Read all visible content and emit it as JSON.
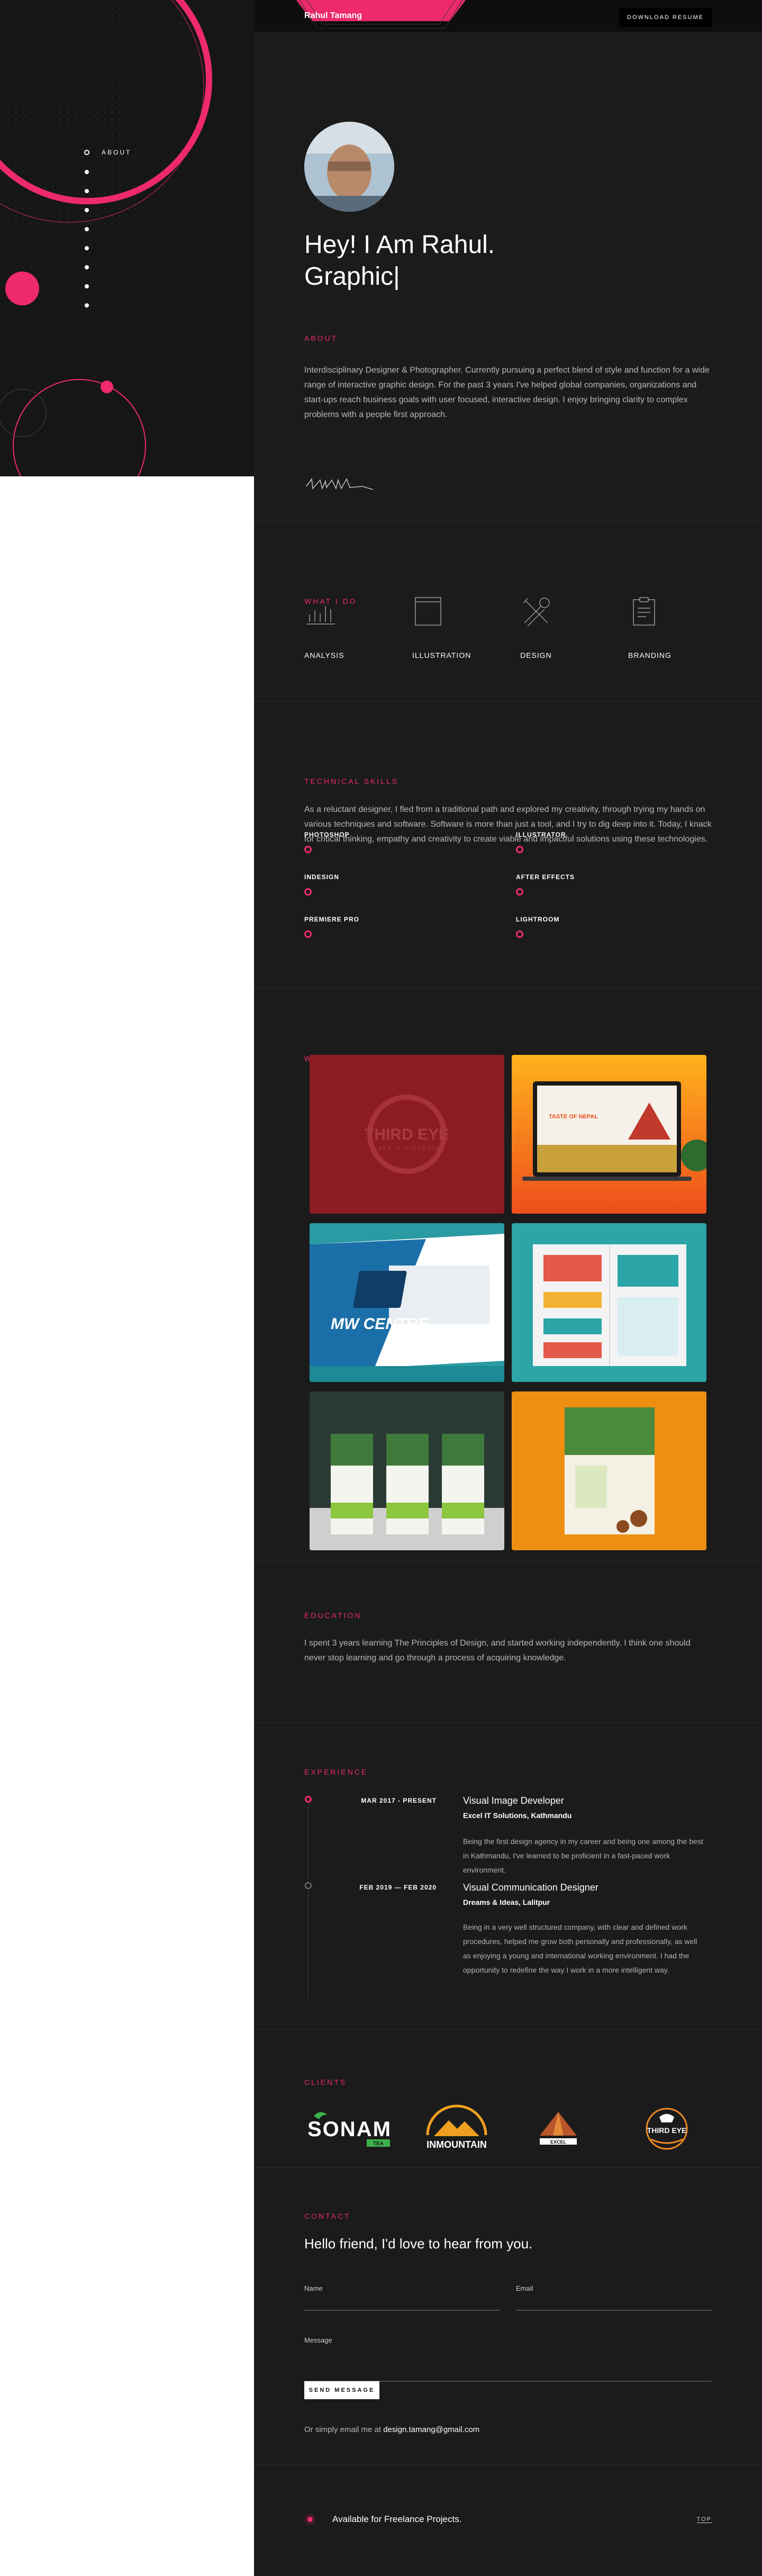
{
  "header": {
    "brand": "Rahul Tamang",
    "resume_button": "DOWNLOAD RESUME"
  },
  "sidenav": {
    "active_label": "ABOUT",
    "items": [
      "about",
      "what-i-do",
      "technical-skills",
      "work",
      "education",
      "experience",
      "clients",
      "contact",
      "footer"
    ]
  },
  "hero": {
    "greeting": "Hey! I Am Rahul.",
    "role": "Graphic"
  },
  "about": {
    "title": "ABOUT",
    "text": "Interdisciplinary Designer & Photographer. Currently pursuing a perfect blend of style and function for a wide range of interactive graphic design. For the past 3 years I've helped global companies, organizations and start-ups reach business goals with user focused, interactive design. I enjoy bringing clarity to complex problems with a people first approach."
  },
  "services": {
    "title": "WHAT I DO",
    "items": [
      {
        "label": "ANALYSIS",
        "icon": "bar-chart-icon"
      },
      {
        "label": "ILLUSTRATION",
        "icon": "browser-window-icon"
      },
      {
        "label": "DESIGN",
        "icon": "tools-icon"
      },
      {
        "label": "BRANDING",
        "icon": "clipboard-icon"
      }
    ]
  },
  "skills": {
    "title": "TECHNICAL SKILLS",
    "text": "As a reluctant designer, I fled from a traditional path and explored my creativity, through trying my hands on various techniques and software. Software is more than just a tool, and I try to dig deep into it. Today, I knack for critical thinking, empathy and creativity to create viable and impactful solutions using these technologies.",
    "items": [
      "PHOTOSHOP",
      "ILLUSTRATOR",
      "INDESIGN",
      "AFTER EFFECTS",
      "PREMIERE PRO",
      "LIGHTROOM"
    ]
  },
  "work": {
    "title": "WORK",
    "items": [
      {
        "name": "third-eye-logo-work",
        "caption": "THIRD EYE",
        "sub": "CAFE & PIZZERIA"
      },
      {
        "name": "taste-of-home-web-work",
        "caption": "TASTE OF NEPAL"
      },
      {
        "name": "mw-centre-work",
        "caption": "MW CENTRE"
      },
      {
        "name": "brochure-work",
        "caption": ""
      },
      {
        "name": "tea-packaging-work",
        "caption": ""
      },
      {
        "name": "pouch-packaging-work",
        "caption": ""
      }
    ]
  },
  "education": {
    "title": "EDUCATION",
    "text": "I spent 3 years learning The Principles of Design, and started working independently. I think one should never stop learning and go through a process of acquiring knowledge."
  },
  "experience": {
    "title": "EXPERIENCE",
    "items": [
      {
        "date": "MAR 2017 - PRESENT",
        "role": "Visual Image Developer",
        "company": "Excel IT Solutions, Kathmandu",
        "desc": "Being the first design agency in my career and being one among the best in Kathmandu, I've learned to be proficient in a fast-paced work environment."
      },
      {
        "date": "FEB 2019 — FEB 2020",
        "role": "Visual Communication Designer",
        "company": "Dreams & Ideas, Lalitpur",
        "desc": "Being in a very well structured company, with clear and defined work procedures, helped me grow both personally and professionally, as well as enjoying a young and international working environment. I had the opportunity to redefine the way I work in a more intelligent way."
      }
    ]
  },
  "clients": {
    "title": "CLIENTS",
    "items": [
      {
        "name": "sonam-logo",
        "text": "SONAM",
        "sub": "TEA"
      },
      {
        "name": "inmountain-logo",
        "text": "INMOUNTAIN"
      },
      {
        "name": "pyramid-logo",
        "text": "EXCEL"
      },
      {
        "name": "third-eye-client-logo",
        "text": "THIRD EYE"
      }
    ]
  },
  "contact": {
    "title": "CONTACT",
    "heading": "Hello friend, I'd love to hear from you.",
    "name_label": "Name",
    "email_label": "Email",
    "message_label": "Message",
    "send_button": "SEND MESSAGE",
    "email_prefix": "Or simply email me at ",
    "email": "design.tamang@gmail.com"
  },
  "footer": {
    "availability": "Available for Freelance Projects.",
    "top_link": "TOP"
  },
  "colors": {
    "accent": "#ee2a6c",
    "background": "#1b1b1b",
    "panel": "#161616"
  }
}
